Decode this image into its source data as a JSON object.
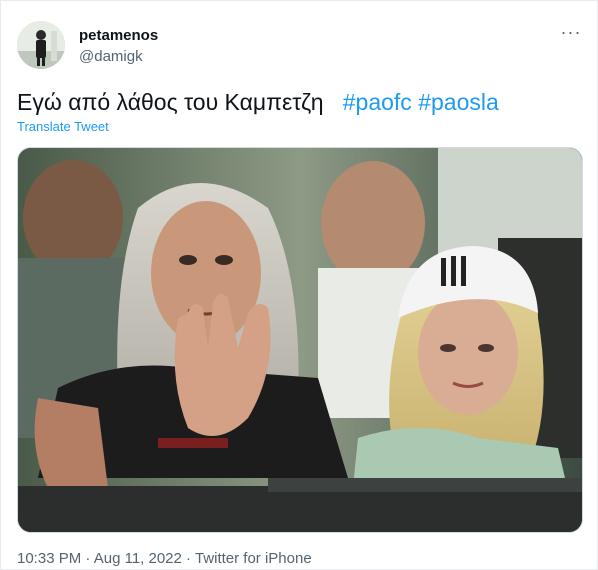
{
  "user": {
    "display_name": "petamenos",
    "handle": "@damigk",
    "avatar_icon": "user-avatar-image"
  },
  "header": {
    "more_icon": "more-options-icon",
    "more_label": "···"
  },
  "tweet": {
    "text": "Εγώ από λάθος του Καμπετζη",
    "hashtags": [
      "#paofc",
      "#paosla"
    ],
    "translate_label": "Translate Tweet"
  },
  "media": {
    "kind": "photo"
  },
  "meta": {
    "time": "10:33 PM",
    "separator": " · ",
    "date": "Aug 11, 2022",
    "source": "Twitter for iPhone"
  },
  "colors": {
    "link": "#1d9bf0",
    "secondary_text": "#536471",
    "primary_text": "#0f1419"
  }
}
